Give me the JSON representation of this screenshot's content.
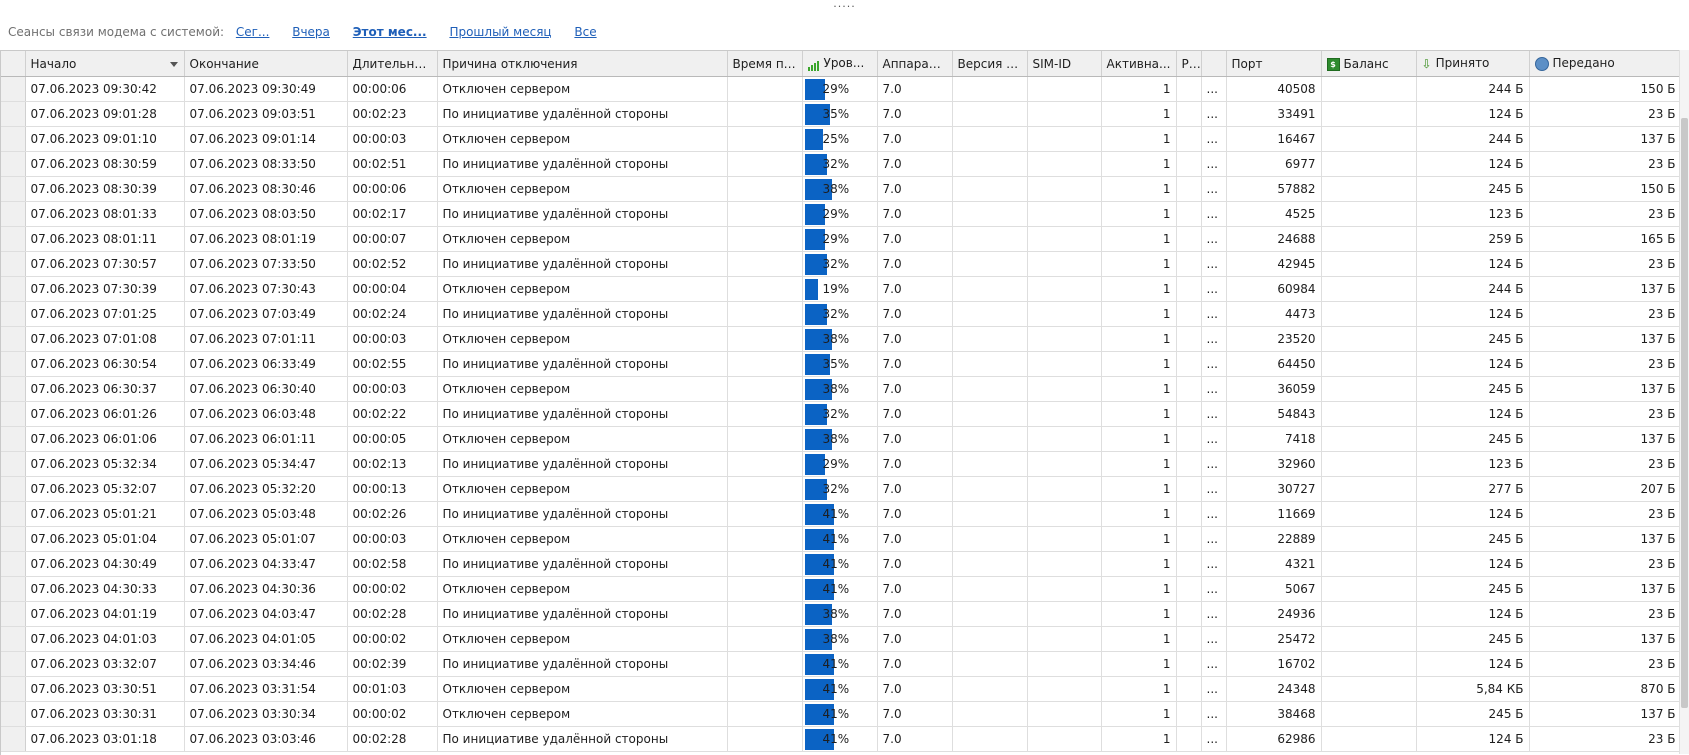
{
  "window": {
    "grip": "....."
  },
  "filter": {
    "label": "Сеансы связи модема с системой:",
    "links": [
      "Сег...",
      "Вчера",
      "Этот мес...",
      "Прошлый месяц",
      "Все"
    ]
  },
  "columns": [
    "Начало",
    "Окончание",
    "Длительно...",
    "Причина отключения",
    "Время по...",
    "Уров...",
    "Аппарат...",
    "Версия п...",
    "SIM-ID",
    "Активна...",
    "PIN",
    "Порт",
    "Баланс",
    "Принято",
    "Передано"
  ],
  "icons": {
    "signal": "signal-bars-icon",
    "balance": "money-icon",
    "received": "download-icon",
    "sent": "upload-globe-icon"
  },
  "colors": {
    "signal_bar": "#0b63c4",
    "link": "#1f5fb8"
  },
  "rows": [
    {
      "start": "07.06.2023 09:30:42",
      "end": "07.06.2023 09:30:49",
      "dur": "00:00:06",
      "reason": "Отключен сервером",
      "time": "",
      "level": "29%",
      "hw": "7.0",
      "ver": "",
      "sim": "",
      "active": "1",
      "pin": "...",
      "port": "40508",
      "balance": "",
      "recv": "244 Б",
      "sent": "150 Б"
    },
    {
      "start": "07.06.2023 09:01:28",
      "end": "07.06.2023 09:03:51",
      "dur": "00:02:23",
      "reason": "По инициативе удалённой стороны",
      "time": "",
      "level": "35%",
      "hw": "7.0",
      "ver": "",
      "sim": "",
      "active": "1",
      "pin": "...",
      "port": "33491",
      "balance": "",
      "recv": "124 Б",
      "sent": "23 Б"
    },
    {
      "start": "07.06.2023 09:01:10",
      "end": "07.06.2023 09:01:14",
      "dur": "00:00:03",
      "reason": "Отключен сервером",
      "time": "",
      "level": "25%",
      "hw": "7.0",
      "ver": "",
      "sim": "",
      "active": "1",
      "pin": "...",
      "port": "16467",
      "balance": "",
      "recv": "244 Б",
      "sent": "137 Б"
    },
    {
      "start": "07.06.2023 08:30:59",
      "end": "07.06.2023 08:33:50",
      "dur": "00:02:51",
      "reason": "По инициативе удалённой стороны",
      "time": "",
      "level": "32%",
      "hw": "7.0",
      "ver": "",
      "sim": "",
      "active": "1",
      "pin": "...",
      "port": "6977",
      "balance": "",
      "recv": "124 Б",
      "sent": "23 Б"
    },
    {
      "start": "07.06.2023 08:30:39",
      "end": "07.06.2023 08:30:46",
      "dur": "00:00:06",
      "reason": "Отключен сервером",
      "time": "",
      "level": "38%",
      "hw": "7.0",
      "ver": "",
      "sim": "",
      "active": "1",
      "pin": "...",
      "port": "57882",
      "balance": "",
      "recv": "245 Б",
      "sent": "150 Б"
    },
    {
      "start": "07.06.2023 08:01:33",
      "end": "07.06.2023 08:03:50",
      "dur": "00:02:17",
      "reason": "По инициативе удалённой стороны",
      "time": "",
      "level": "29%",
      "hw": "7.0",
      "ver": "",
      "sim": "",
      "active": "1",
      "pin": "...",
      "port": "4525",
      "balance": "",
      "recv": "123 Б",
      "sent": "23 Б"
    },
    {
      "start": "07.06.2023 08:01:11",
      "end": "07.06.2023 08:01:19",
      "dur": "00:00:07",
      "reason": "Отключен сервером",
      "time": "",
      "level": "29%",
      "hw": "7.0",
      "ver": "",
      "sim": "",
      "active": "1",
      "pin": "...",
      "port": "24688",
      "balance": "",
      "recv": "259 Б",
      "sent": "165 Б"
    },
    {
      "start": "07.06.2023 07:30:57",
      "end": "07.06.2023 07:33:50",
      "dur": "00:02:52",
      "reason": "По инициативе удалённой стороны",
      "time": "",
      "level": "32%",
      "hw": "7.0",
      "ver": "",
      "sim": "",
      "active": "1",
      "pin": "...",
      "port": "42945",
      "balance": "",
      "recv": "124 Б",
      "sent": "23 Б"
    },
    {
      "start": "07.06.2023 07:30:39",
      "end": "07.06.2023 07:30:43",
      "dur": "00:00:04",
      "reason": "Отключен сервером",
      "time": "",
      "level": "19%",
      "hw": "7.0",
      "ver": "",
      "sim": "",
      "active": "1",
      "pin": "...",
      "port": "60984",
      "balance": "",
      "recv": "244 Б",
      "sent": "137 Б"
    },
    {
      "start": "07.06.2023 07:01:25",
      "end": "07.06.2023 07:03:49",
      "dur": "00:02:24",
      "reason": "По инициативе удалённой стороны",
      "time": "",
      "level": "32%",
      "hw": "7.0",
      "ver": "",
      "sim": "",
      "active": "1",
      "pin": "...",
      "port": "4473",
      "balance": "",
      "recv": "124 Б",
      "sent": "23 Б"
    },
    {
      "start": "07.06.2023 07:01:08",
      "end": "07.06.2023 07:01:11",
      "dur": "00:00:03",
      "reason": "Отключен сервером",
      "time": "",
      "level": "38%",
      "hw": "7.0",
      "ver": "",
      "sim": "",
      "active": "1",
      "pin": "...",
      "port": "23520",
      "balance": "",
      "recv": "245 Б",
      "sent": "137 Б"
    },
    {
      "start": "07.06.2023 06:30:54",
      "end": "07.06.2023 06:33:49",
      "dur": "00:02:55",
      "reason": "По инициативе удалённой стороны",
      "time": "",
      "level": "35%",
      "hw": "7.0",
      "ver": "",
      "sim": "",
      "active": "1",
      "pin": "...",
      "port": "64450",
      "balance": "",
      "recv": "124 Б",
      "sent": "23 Б"
    },
    {
      "start": "07.06.2023 06:30:37",
      "end": "07.06.2023 06:30:40",
      "dur": "00:00:03",
      "reason": "Отключен сервером",
      "time": "",
      "level": "38%",
      "hw": "7.0",
      "ver": "",
      "sim": "",
      "active": "1",
      "pin": "...",
      "port": "36059",
      "balance": "",
      "recv": "245 Б",
      "sent": "137 Б"
    },
    {
      "start": "07.06.2023 06:01:26",
      "end": "07.06.2023 06:03:48",
      "dur": "00:02:22",
      "reason": "По инициативе удалённой стороны",
      "time": "",
      "level": "32%",
      "hw": "7.0",
      "ver": "",
      "sim": "",
      "active": "1",
      "pin": "...",
      "port": "54843",
      "balance": "",
      "recv": "124 Б",
      "sent": "23 Б"
    },
    {
      "start": "07.06.2023 06:01:06",
      "end": "07.06.2023 06:01:11",
      "dur": "00:00:05",
      "reason": "Отключен сервером",
      "time": "",
      "level": "38%",
      "hw": "7.0",
      "ver": "",
      "sim": "",
      "active": "1",
      "pin": "...",
      "port": "7418",
      "balance": "",
      "recv": "245 Б",
      "sent": "137 Б"
    },
    {
      "start": "07.06.2023 05:32:34",
      "end": "07.06.2023 05:34:47",
      "dur": "00:02:13",
      "reason": "По инициативе удалённой стороны",
      "time": "",
      "level": "29%",
      "hw": "7.0",
      "ver": "",
      "sim": "",
      "active": "1",
      "pin": "...",
      "port": "32960",
      "balance": "",
      "recv": "123 Б",
      "sent": "23 Б"
    },
    {
      "start": "07.06.2023 05:32:07",
      "end": "07.06.2023 05:32:20",
      "dur": "00:00:13",
      "reason": "Отключен сервером",
      "time": "",
      "level": "32%",
      "hw": "7.0",
      "ver": "",
      "sim": "",
      "active": "1",
      "pin": "...",
      "port": "30727",
      "balance": "",
      "recv": "277 Б",
      "sent": "207 Б"
    },
    {
      "start": "07.06.2023 05:01:21",
      "end": "07.06.2023 05:03:48",
      "dur": "00:02:26",
      "reason": "По инициативе удалённой стороны",
      "time": "",
      "level": "41%",
      "hw": "7.0",
      "ver": "",
      "sim": "",
      "active": "1",
      "pin": "...",
      "port": "11669",
      "balance": "",
      "recv": "124 Б",
      "sent": "23 Б"
    },
    {
      "start": "07.06.2023 05:01:04",
      "end": "07.06.2023 05:01:07",
      "dur": "00:00:03",
      "reason": "Отключен сервером",
      "time": "",
      "level": "41%",
      "hw": "7.0",
      "ver": "",
      "sim": "",
      "active": "1",
      "pin": "...",
      "port": "22889",
      "balance": "",
      "recv": "245 Б",
      "sent": "137 Б"
    },
    {
      "start": "07.06.2023 04:30:49",
      "end": "07.06.2023 04:33:47",
      "dur": "00:02:58",
      "reason": "По инициативе удалённой стороны",
      "time": "",
      "level": "41%",
      "hw": "7.0",
      "ver": "",
      "sim": "",
      "active": "1",
      "pin": "...",
      "port": "4321",
      "balance": "",
      "recv": "124 Б",
      "sent": "23 Б"
    },
    {
      "start": "07.06.2023 04:30:33",
      "end": "07.06.2023 04:30:36",
      "dur": "00:00:02",
      "reason": "Отключен сервером",
      "time": "",
      "level": "41%",
      "hw": "7.0",
      "ver": "",
      "sim": "",
      "active": "1",
      "pin": "...",
      "port": "5067",
      "balance": "",
      "recv": "245 Б",
      "sent": "137 Б"
    },
    {
      "start": "07.06.2023 04:01:19",
      "end": "07.06.2023 04:03:47",
      "dur": "00:02:28",
      "reason": "По инициативе удалённой стороны",
      "time": "",
      "level": "38%",
      "hw": "7.0",
      "ver": "",
      "sim": "",
      "active": "1",
      "pin": "...",
      "port": "24936",
      "balance": "",
      "recv": "124 Б",
      "sent": "23 Б"
    },
    {
      "start": "07.06.2023 04:01:03",
      "end": "07.06.2023 04:01:05",
      "dur": "00:00:02",
      "reason": "Отключен сервером",
      "time": "",
      "level": "38%",
      "hw": "7.0",
      "ver": "",
      "sim": "",
      "active": "1",
      "pin": "...",
      "port": "25472",
      "balance": "",
      "recv": "245 Б",
      "sent": "137 Б"
    },
    {
      "start": "07.06.2023 03:32:07",
      "end": "07.06.2023 03:34:46",
      "dur": "00:02:39",
      "reason": "По инициативе удалённой стороны",
      "time": "",
      "level": "41%",
      "hw": "7.0",
      "ver": "",
      "sim": "",
      "active": "1",
      "pin": "...",
      "port": "16702",
      "balance": "",
      "recv": "124 Б",
      "sent": "23 Б"
    },
    {
      "start": "07.06.2023 03:30:51",
      "end": "07.06.2023 03:31:54",
      "dur": "00:01:03",
      "reason": "Отключен сервером",
      "time": "",
      "level": "41%",
      "hw": "7.0",
      "ver": "",
      "sim": "",
      "active": "1",
      "pin": "...",
      "port": "24348",
      "balance": "",
      "recv": "5,84 КБ",
      "sent": "870 Б"
    },
    {
      "start": "07.06.2023 03:30:31",
      "end": "07.06.2023 03:30:34",
      "dur": "00:00:02",
      "reason": "Отключен сервером",
      "time": "",
      "level": "41%",
      "hw": "7.0",
      "ver": "",
      "sim": "",
      "active": "1",
      "pin": "...",
      "port": "38468",
      "balance": "",
      "recv": "245 Б",
      "sent": "137 Б"
    },
    {
      "start": "07.06.2023 03:01:18",
      "end": "07.06.2023 03:03:46",
      "dur": "00:02:28",
      "reason": "По инициативе удалённой стороны",
      "time": "",
      "level": "41%",
      "hw": "7.0",
      "ver": "",
      "sim": "",
      "active": "1",
      "pin": "...",
      "port": "62986",
      "balance": "",
      "recv": "124 Б",
      "sent": "23 Б"
    }
  ]
}
